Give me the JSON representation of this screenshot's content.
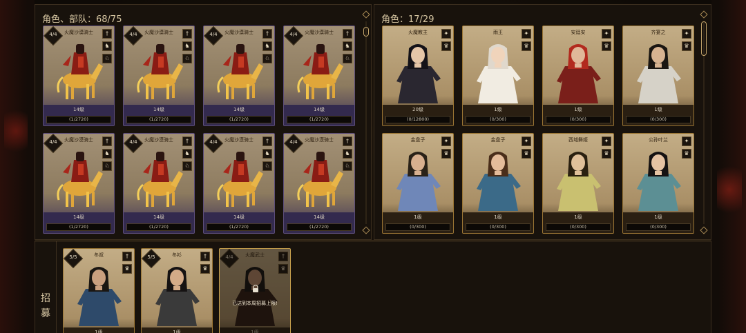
{
  "left_panel": {
    "title": "角色、部队：68/75",
    "troops": [
      {
        "name": "火魔沙漠骑士",
        "count": "4/4",
        "level": "14级",
        "exp": "(1/2720)"
      },
      {
        "name": "火魔沙漠骑士",
        "count": "4/4",
        "level": "14级",
        "exp": "(1/2720)"
      },
      {
        "name": "火魔沙漠骑士",
        "count": "4/4",
        "level": "14级",
        "exp": "(1/2720)"
      },
      {
        "name": "火魔沙漠骑士",
        "count": "4/4",
        "level": "14级",
        "exp": "(1/2720)"
      },
      {
        "name": "火魔沙漠骑士",
        "count": "4/4",
        "level": "14级",
        "exp": "(1/2720)"
      },
      {
        "name": "火魔沙漠骑士",
        "count": "4/4",
        "level": "14级",
        "exp": "(1/2720)"
      },
      {
        "name": "火魔沙漠骑士",
        "count": "4/4",
        "level": "14级",
        "exp": "(1/2720)"
      },
      {
        "name": "火魔沙漠骑士",
        "count": "4/4",
        "level": "14级",
        "exp": "(1/2720)"
      }
    ]
  },
  "right_panel": {
    "title": "角色：17/29",
    "heroes": [
      {
        "name": "火魔教主",
        "level": "20级",
        "exp": "(0/12800)",
        "robe": "#2a2730",
        "hair": "#141218",
        "skin": "#e5c6a8"
      },
      {
        "name": "雨王",
        "level": "1级",
        "exp": "(0/300)",
        "robe": "#f1ece2",
        "hair": "#e0d8cc",
        "skin": "#f0d4bb"
      },
      {
        "name": "安廷安",
        "level": "1级",
        "exp": "(0/300)",
        "robe": "#7a1f1a",
        "hair": "#b22a1e",
        "skin": "#e0b899"
      },
      {
        "name": "齐宴之",
        "level": "1级",
        "exp": "(0/300)",
        "robe": "#d6d2c8",
        "hair": "#1a1612",
        "skin": "#d7b391"
      },
      {
        "name": "金盘子",
        "level": "1级",
        "exp": "(0/300)",
        "robe": "#6f87b8",
        "hair": "#2a2218",
        "skin": "#d8b08f"
      },
      {
        "name": "金盘子",
        "level": "1级",
        "exp": "(0/300)",
        "robe": "#3b6a88",
        "hair": "#4a2e1a",
        "skin": "#e4bc9a"
      },
      {
        "name": "西域舞姬",
        "level": "1级",
        "exp": "(0/300)",
        "robe": "#c9c070",
        "hair": "#2a2010",
        "skin": "#e0c09a"
      },
      {
        "name": "公孙叶兰",
        "level": "1级",
        "exp": "(0/300)",
        "robe": "#5c8f94",
        "hair": "#151212",
        "skin": "#e5c3a3"
      }
    ]
  },
  "recruit": {
    "label": "招募",
    "units": [
      {
        "name": "冬叔",
        "count": "5/5",
        "level": "1级",
        "locked": false,
        "robe": "#2e4a6a",
        "hair": "#1a1612",
        "skin": "#c99f7e"
      },
      {
        "name": "冬衫",
        "count": "5/5",
        "level": "1级",
        "locked": false,
        "robe": "#3a3a3a",
        "hair": "#151212",
        "skin": "#d4ab88"
      },
      {
        "name": "火魔武士",
        "count": "4/4",
        "level": "1级",
        "locked": true,
        "lock_text": "已达到本周招募上限!",
        "robe": "#2a1a12",
        "hair": "#111111",
        "skin": "#b88a6a"
      }
    ]
  },
  "icons": {
    "badge": "level-diamond-icon",
    "weapon": "sword-icon",
    "horse": "horse-icon",
    "armor": "armor-icon",
    "lock": "lock-icon",
    "dice": "dice-icon"
  },
  "colors": {
    "panel_bg": "#18120c",
    "panel_border": "#3b2e1e",
    "gold_border": "#9a7534",
    "troop_band": "#332a4e",
    "title_text": "#d7c7a3"
  }
}
